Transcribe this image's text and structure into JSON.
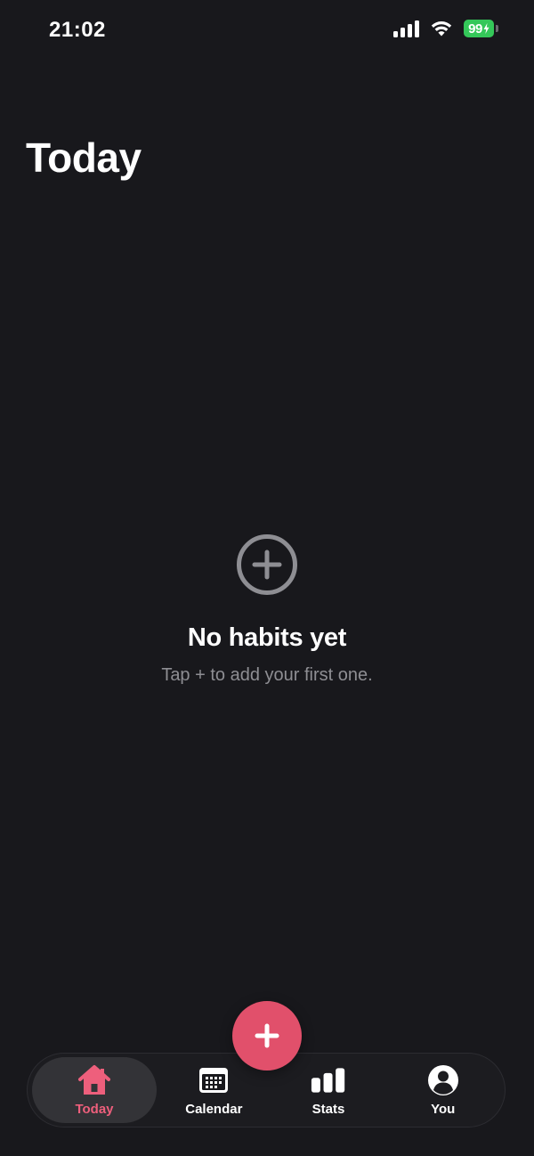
{
  "status_bar": {
    "time": "21:02",
    "battery_level": "99",
    "battery_color": "#34c759",
    "icons": [
      "signal-icon",
      "wifi-icon",
      "battery-icon"
    ]
  },
  "header": {
    "title": "Today"
  },
  "empty_state": {
    "icon": "plus-circle-icon",
    "title": "No habits yet",
    "subtitle": "Tap + to add your first one."
  },
  "fab": {
    "icon": "plus-icon",
    "color": "#e1506b"
  },
  "tab_bar": {
    "accent_color": "#ee5f7c",
    "tabs": [
      {
        "label": "Today",
        "icon": "home-icon",
        "active": true
      },
      {
        "label": "Calendar",
        "icon": "calendar-icon",
        "active": false
      },
      {
        "label": "Stats",
        "icon": "stats-icon",
        "active": false
      },
      {
        "label": "You",
        "icon": "profile-icon",
        "active": false
      }
    ]
  }
}
